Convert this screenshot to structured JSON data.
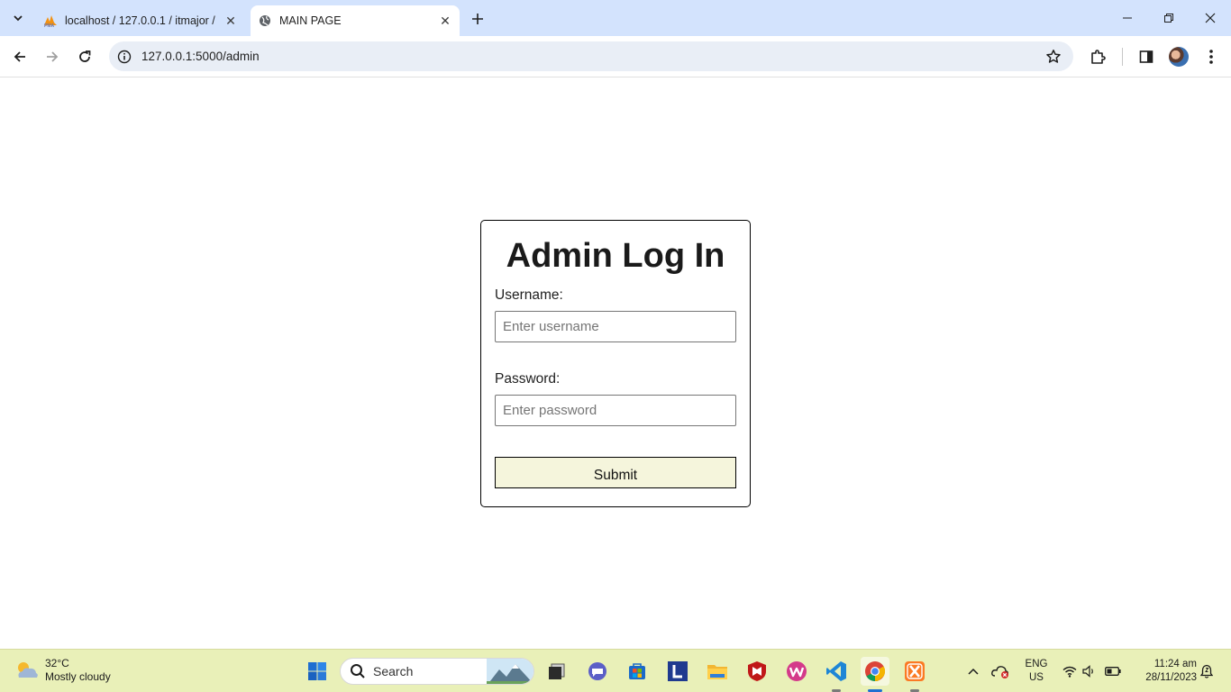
{
  "browser": {
    "tabs": [
      {
        "title": "localhost / 127.0.0.1 / itmajor / ",
        "favicon": "phpmyadmin-icon",
        "active": false
      },
      {
        "title": "MAIN PAGE",
        "favicon": "globe-icon",
        "active": true
      }
    ],
    "url": "127.0.0.1:5000/admin"
  },
  "page": {
    "title": "Admin Log In",
    "username_label": "Username:",
    "username_placeholder": "Enter username",
    "username_value": "",
    "password_label": "Password:",
    "password_placeholder": "Enter password",
    "password_value": "",
    "submit_label": "Submit",
    "submit_bg": "#f5f5dc"
  },
  "taskbar": {
    "weather_temp": "32°C",
    "weather_desc": "Mostly cloudy",
    "search_placeholder": "Search",
    "apps": [
      "windows-start-icon",
      "file-explorer-dark-icon",
      "teams-chat-icon",
      "microsoft-store-icon",
      "l-app-icon",
      "folder-icon",
      "mcafee-icon",
      "wps-office-icon",
      "vscode-icon",
      "chrome-icon",
      "xampp-icon"
    ],
    "lang_line1": "ENG",
    "lang_line2": "US",
    "time": "11:24 am",
    "date": "28/11/2023"
  }
}
